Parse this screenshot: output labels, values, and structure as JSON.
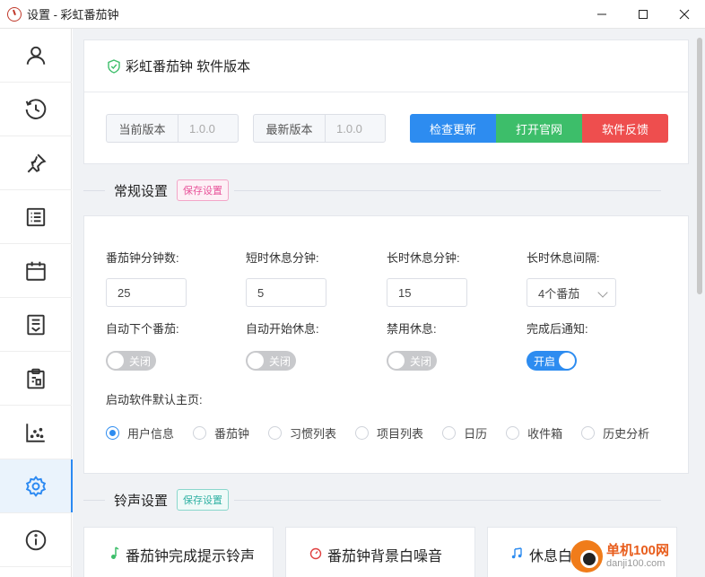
{
  "window": {
    "title": "设置 - 彩虹番茄钟"
  },
  "sidebar": {
    "items": [
      {
        "icon": "user-icon"
      },
      {
        "icon": "clock-icon"
      },
      {
        "icon": "pin-icon"
      },
      {
        "icon": "list-icon"
      },
      {
        "icon": "calendar-icon"
      },
      {
        "icon": "inbox-icon"
      },
      {
        "icon": "clipboard-icon"
      },
      {
        "icon": "scatter-chart-icon"
      },
      {
        "icon": "gear-icon",
        "active": true
      },
      {
        "icon": "info-icon"
      }
    ]
  },
  "version": {
    "title": "彩虹番茄钟 软件版本",
    "current_label": "当前版本",
    "current_value": "1.0.0",
    "latest_label": "最新版本",
    "latest_value": "1.0.0",
    "check_update": "检查更新",
    "open_website": "打开官网",
    "feedback": "软件反馈"
  },
  "general": {
    "title": "常规设置",
    "save_tag": "保存设置",
    "pomodoro_minutes_label": "番茄钟分钟数:",
    "pomodoro_minutes": "25",
    "short_break_label": "短时休息分钟:",
    "short_break": "5",
    "long_break_label": "长时休息分钟:",
    "long_break": "15",
    "long_break_interval_label": "长时休息间隔:",
    "long_break_interval": "4个番茄",
    "auto_next_label": "自动下个番茄:",
    "auto_next": "关闭",
    "auto_break_label": "自动开始休息:",
    "auto_break": "关闭",
    "disable_break_label": "禁用休息:",
    "disable_break": "关闭",
    "notify_label": "完成后通知:",
    "notify": "开启",
    "default_page_label": "启动软件默认主页:",
    "pages": [
      "用户信息",
      "番茄钟",
      "习惯列表",
      "项目列表",
      "日历",
      "收件箱",
      "历史分析"
    ],
    "selected_page": "用户信息"
  },
  "sound": {
    "title": "铃声设置",
    "save_tag": "保存设置",
    "cards": [
      "番茄钟完成提示铃声",
      "番茄钟背景白噪音",
      "休息白噪音"
    ]
  },
  "watermark": {
    "name": "单机100网",
    "url": "danji100.com"
  },
  "colors": {
    "accent": "#2d8cf0",
    "green": "#3dbe6a",
    "red": "#ee4e4e"
  }
}
